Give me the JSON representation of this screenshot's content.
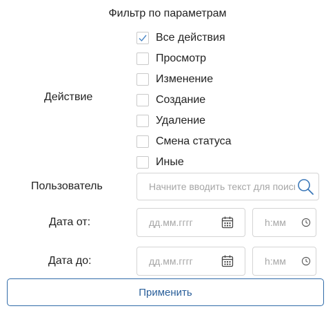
{
  "title": "Фильтр по параметрам",
  "action": {
    "label": "Действие",
    "options": [
      {
        "label": "Все действия",
        "checked": true
      },
      {
        "label": "Просмотр",
        "checked": false
      },
      {
        "label": "Изменение",
        "checked": false
      },
      {
        "label": "Создание",
        "checked": false
      },
      {
        "label": "Удаление",
        "checked": false
      },
      {
        "label": "Смена статуса",
        "checked": false
      },
      {
        "label": "Иные",
        "checked": false
      }
    ]
  },
  "user": {
    "label": "Пользователь",
    "placeholder": "Начните вводить текст для поиска",
    "icon": "search-icon"
  },
  "date_from": {
    "label": "Дата от:",
    "date_placeholder": "дд.мм.гггг",
    "time_placeholder": "h:мм",
    "date_icon": "calendar-icon",
    "time_icon": "clock-icon"
  },
  "date_to": {
    "label": "Дата до:",
    "date_placeholder": "дд.мм.гггг",
    "time_placeholder": "h:мм",
    "date_icon": "calendar-icon",
    "time_icon": "clock-icon"
  },
  "apply_label": "Применить",
  "colors": {
    "accent": "#2f6aa8",
    "check": "#4a86c5",
    "placeholder": "#a6a6a6",
    "border": "#d4d4d4"
  }
}
